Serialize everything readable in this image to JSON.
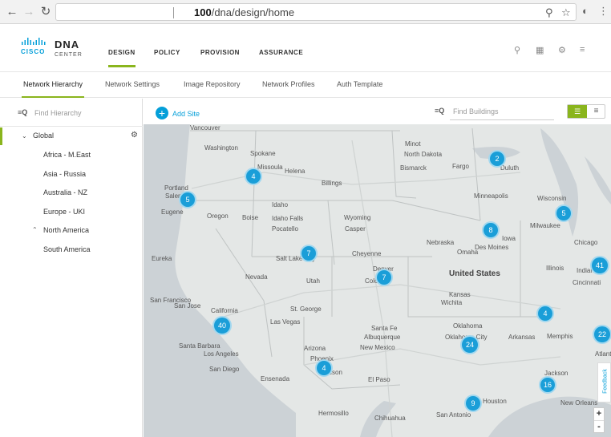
{
  "browser": {
    "url_bold": "100",
    "url_rest": "/dna/design/home",
    "back_icon": "arrow-left-icon",
    "forward_icon": "arrow-right-icon",
    "reload_icon": "reload-icon"
  },
  "app": {
    "logo_brand": "CISCO",
    "logo_title": "DNA",
    "logo_subtitle": "CENTER",
    "accent_color": "#8ab51d",
    "primary_color": "#049fd9",
    "main_nav": [
      {
        "label": "DESIGN",
        "active": true
      },
      {
        "label": "POLICY"
      },
      {
        "label": "PROVISION"
      },
      {
        "label": "ASSURANCE"
      }
    ]
  },
  "sub_tabs": [
    {
      "label": "Network Hierarchy",
      "active": true
    },
    {
      "label": "Network Settings"
    },
    {
      "label": "Image Repository"
    },
    {
      "label": "Network Profiles"
    },
    {
      "label": "Auth Template"
    }
  ],
  "sidebar": {
    "search_placeholder": "Find Hierarchy",
    "tree": [
      {
        "label": "Global",
        "expanded": true
      },
      {
        "label": "Africa - M.East"
      },
      {
        "label": "Asia - Russia"
      },
      {
        "label": "Australia - NZ"
      },
      {
        "label": "Europe - UKI"
      },
      {
        "label": "North America",
        "expanded": true
      },
      {
        "label": "South America"
      }
    ]
  },
  "map_toolbar": {
    "add_site_label": "Add Site",
    "buildings_placeholder": "Find Buildings"
  },
  "map": {
    "cities": [
      "Vancouver",
      "Washington",
      "Spokane",
      "Missoula",
      "Helena",
      "Billings",
      "Minot",
      "North Dakota",
      "Bismarck",
      "Fargo",
      "Duluth",
      "Portland",
      "Salem",
      "Eugene",
      "Oregon",
      "Idaho",
      "Boise",
      "Idaho Falls",
      "Pocatello",
      "Wyoming",
      "Casper",
      "Minneapolis",
      "Wisconsin",
      "Milwaukee",
      "Chicago",
      "Nebraska",
      "Iowa",
      "Des Moines",
      "Omaha",
      "Cheyenne",
      "Salt Lake City",
      "Eureka",
      "Nevada",
      "Utah",
      "Denver",
      "Colorado",
      "United States",
      "Kansas",
      "Wichita",
      "Illinois",
      "Indiana",
      "Cincinnati",
      "San Francisco",
      "San Jose",
      "California",
      "St. George",
      "Las Vegas",
      "Santa Fe",
      "Albuquerque",
      "New Mexico",
      "Oklahoma",
      "Oklahoma City",
      "Arkansas",
      "Memphis",
      "Atlanta",
      "Santa Barbara",
      "Los Angeles",
      "San Diego",
      "Ensenada",
      "Arizona",
      "Phoenix",
      "Tucson",
      "El Paso",
      "Jackson",
      "New Orleans",
      "Hermosillo",
      "Chihuahua",
      "San Antonio",
      "Houston"
    ],
    "clusters": [
      {
        "count": "2"
      },
      {
        "count": "4"
      },
      {
        "count": "5"
      },
      {
        "count": "5"
      },
      {
        "count": "8"
      },
      {
        "count": "7"
      },
      {
        "count": "7"
      },
      {
        "count": "41"
      },
      {
        "count": "40"
      },
      {
        "count": "4"
      },
      {
        "count": "22"
      },
      {
        "count": "24"
      },
      {
        "count": "4"
      },
      {
        "count": "16"
      },
      {
        "count": "9"
      }
    ]
  },
  "zoom": {
    "in": "+",
    "out": "-"
  },
  "feedback_label": "Feedback"
}
